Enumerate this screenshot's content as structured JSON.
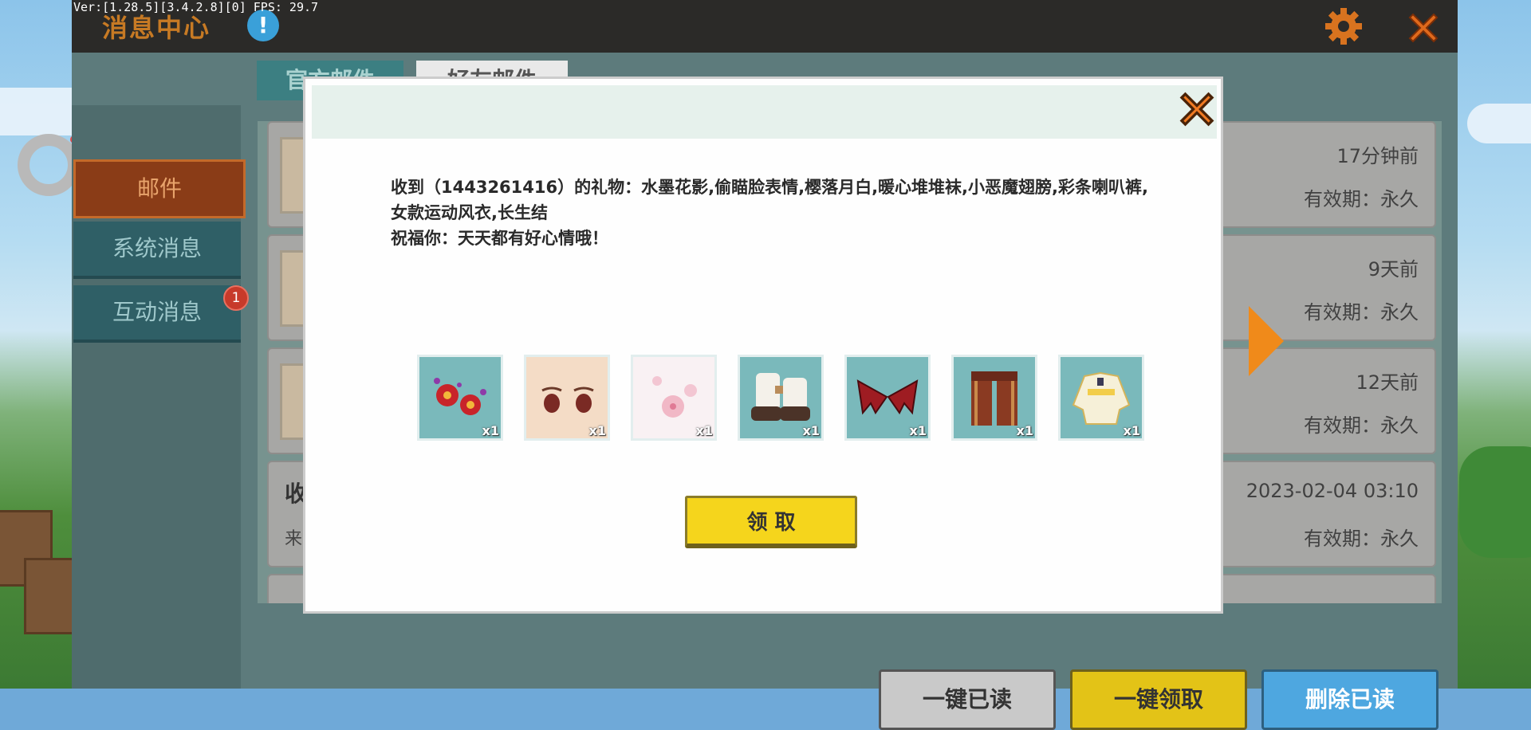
{
  "debug": {
    "fps_text": "Ver:[1.28.5][3.4.2.8][0] FPS: 29.7"
  },
  "header": {
    "title": "消息中心"
  },
  "sidebar": {
    "items": [
      {
        "label": "邮件",
        "active": true
      },
      {
        "label": "系统消息",
        "active": false
      },
      {
        "label": "互动消息",
        "active": false,
        "badge": "1"
      }
    ]
  },
  "tabs": [
    {
      "label": "官方邮件",
      "active": true
    },
    {
      "label": "好友邮件",
      "active": false
    }
  ],
  "mail_list": [
    {
      "title": "",
      "from": "",
      "time": "17分钟前",
      "validity": "有效期：永久"
    },
    {
      "title": "",
      "from": "",
      "time": "9天前",
      "validity": "有效期：永久"
    },
    {
      "title": "",
      "from": "",
      "time": "12天前",
      "validity": "有效期：永久"
    },
    {
      "title": "收",
      "from": "来",
      "time": "2023-02-04 03:10",
      "validity": "有效期：永久"
    }
  ],
  "bottom_buttons": {
    "mark_all_read": "一键已读",
    "claim_all": "一键领取",
    "delete_read": "删除已读"
  },
  "modal": {
    "message_line1": "收到（1443261416）的礼物：水墨花影,偷瞄脸表情,樱落月白,暖心堆堆袜,小恶魔翅膀,彩条喇叭裤,女款运动风衣,长生结",
    "message_line2": "祝福你：天天都有好心情哦！",
    "gifts": [
      {
        "icon": "ink-flower-icon",
        "qty": "x1"
      },
      {
        "icon": "peek-face-icon",
        "qty": "x1"
      },
      {
        "icon": "sakura-moon-icon",
        "qty": "x1"
      },
      {
        "icon": "warm-socks-icon",
        "qty": "x1"
      },
      {
        "icon": "devil-wings-icon",
        "qty": "x1"
      },
      {
        "icon": "striped-pants-icon",
        "qty": "x1"
      },
      {
        "icon": "sport-jacket-icon",
        "qty": "x1"
      }
    ],
    "claim_label": "领 取"
  },
  "colors": {
    "accent_orange": "#f08a1a",
    "claim_yellow": "#f5d51c",
    "delete_blue": "#4ea7e0",
    "panel_teal": "#5d7b7c"
  }
}
